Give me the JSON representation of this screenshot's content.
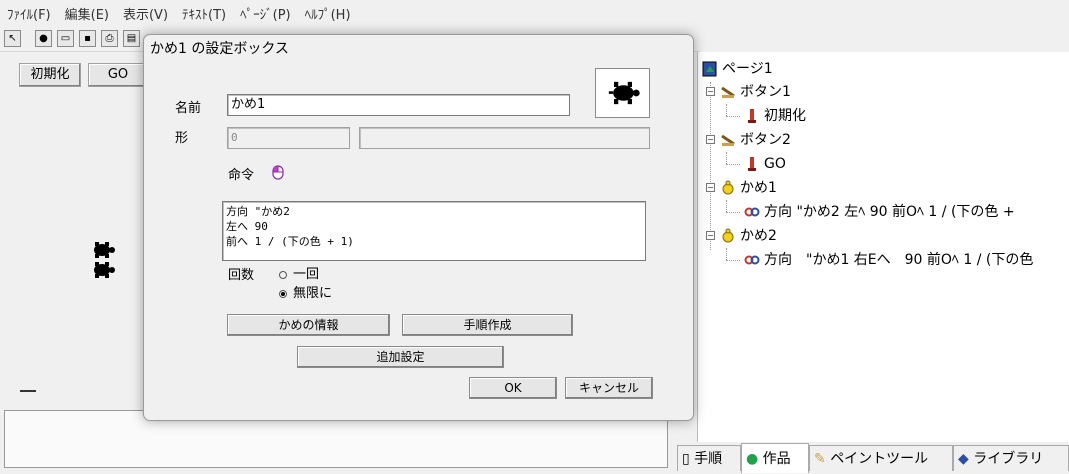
{
  "menu": [
    "ﾌｧｲﾙ(F)",
    "編集(E)",
    "表示(V)",
    "ﾃｷｽﾄ(T)",
    "ﾍﾟｰｼﾞ(P)",
    "ﾍﾙﾌﾟ(H)"
  ],
  "stage": {
    "init_button": "初期化",
    "go_button": "GO"
  },
  "dialog": {
    "title": "かめ1 の設定ボックス",
    "name_label": "名前",
    "name_value": "かめ1",
    "shape_label": "形",
    "shape_value": "0",
    "command_label": "命令",
    "script_lines": [
      "方向 \"かめ2",
      "左へ 90",
      "前へ 1 / (下の色 + 1)"
    ],
    "count_label": "回数",
    "radio_once": "一回",
    "radio_infinite": "無限に",
    "info_button": "かめの情報",
    "procedure_button": "手順作成",
    "extra_button": "追加設定",
    "ok_button": "OK",
    "cancel_button": "キャンセル"
  },
  "tree": {
    "page": "ページ1",
    "button1": "ボタン1",
    "button1_child": "初期化",
    "button2": "ボタン2",
    "button2_child": "GO",
    "turtle1": "かめ1",
    "turtle1_child": "方向 \"かめ2 左ﾍ 90 前Oﾍ 1 / (下の色 +",
    "turtle2": "かめ2",
    "turtle2_child": "方向　\"かめ1 右Eへ　90 前Oﾍ 1 / (下の色"
  },
  "tabs": [
    "手順",
    "作品",
    "ペイントツール",
    "ライブラリ"
  ],
  "colors": {
    "dialog_bg": "#f0f0f0",
    "tree_bg": "#ffffff",
    "title_text": "#000000"
  }
}
